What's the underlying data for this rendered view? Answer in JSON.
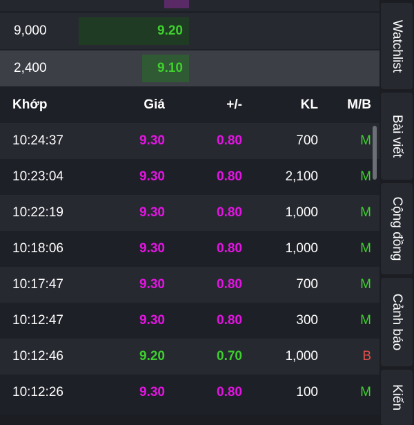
{
  "colors": {
    "ceiling": "#e314e3",
    "up": "#3ecf2e",
    "down": "#e2514b",
    "text": "#ffffff"
  },
  "depth": [
    {
      "volume": "9,000",
      "price": "9.20"
    },
    {
      "volume": "2,400",
      "price": "9.10"
    }
  ],
  "columns": {
    "time": "Khớp",
    "price": "Giá",
    "change": "+/-",
    "volume": "KL",
    "side": "M/B"
  },
  "trades": [
    {
      "time": "10:24:37",
      "price": "9.30",
      "change": "0.80",
      "volume": "700",
      "side": "M",
      "price_color": "ceiling",
      "side_color": "up"
    },
    {
      "time": "10:23:04",
      "price": "9.30",
      "change": "0.80",
      "volume": "2,100",
      "side": "M",
      "price_color": "ceiling",
      "side_color": "up"
    },
    {
      "time": "10:22:19",
      "price": "9.30",
      "change": "0.80",
      "volume": "1,000",
      "side": "M",
      "price_color": "ceiling",
      "side_color": "up"
    },
    {
      "time": "10:18:06",
      "price": "9.30",
      "change": "0.80",
      "volume": "1,000",
      "side": "M",
      "price_color": "ceiling",
      "side_color": "up"
    },
    {
      "time": "10:17:47",
      "price": "9.30",
      "change": "0.80",
      "volume": "700",
      "side": "M",
      "price_color": "ceiling",
      "side_color": "up"
    },
    {
      "time": "10:12:47",
      "price": "9.30",
      "change": "0.80",
      "volume": "300",
      "side": "M",
      "price_color": "ceiling",
      "side_color": "up"
    },
    {
      "time": "10:12:46",
      "price": "9.20",
      "change": "0.70",
      "volume": "1,000",
      "side": "B",
      "price_color": "up",
      "side_color": "down"
    },
    {
      "time": "10:12:26",
      "price": "9.30",
      "change": "0.80",
      "volume": "100",
      "side": "M",
      "price_color": "ceiling",
      "side_color": "up"
    }
  ],
  "side_tabs": [
    "Watchlist",
    "Bài viết",
    "Cộng đồng",
    "Cảnh báo",
    "Kiến"
  ]
}
